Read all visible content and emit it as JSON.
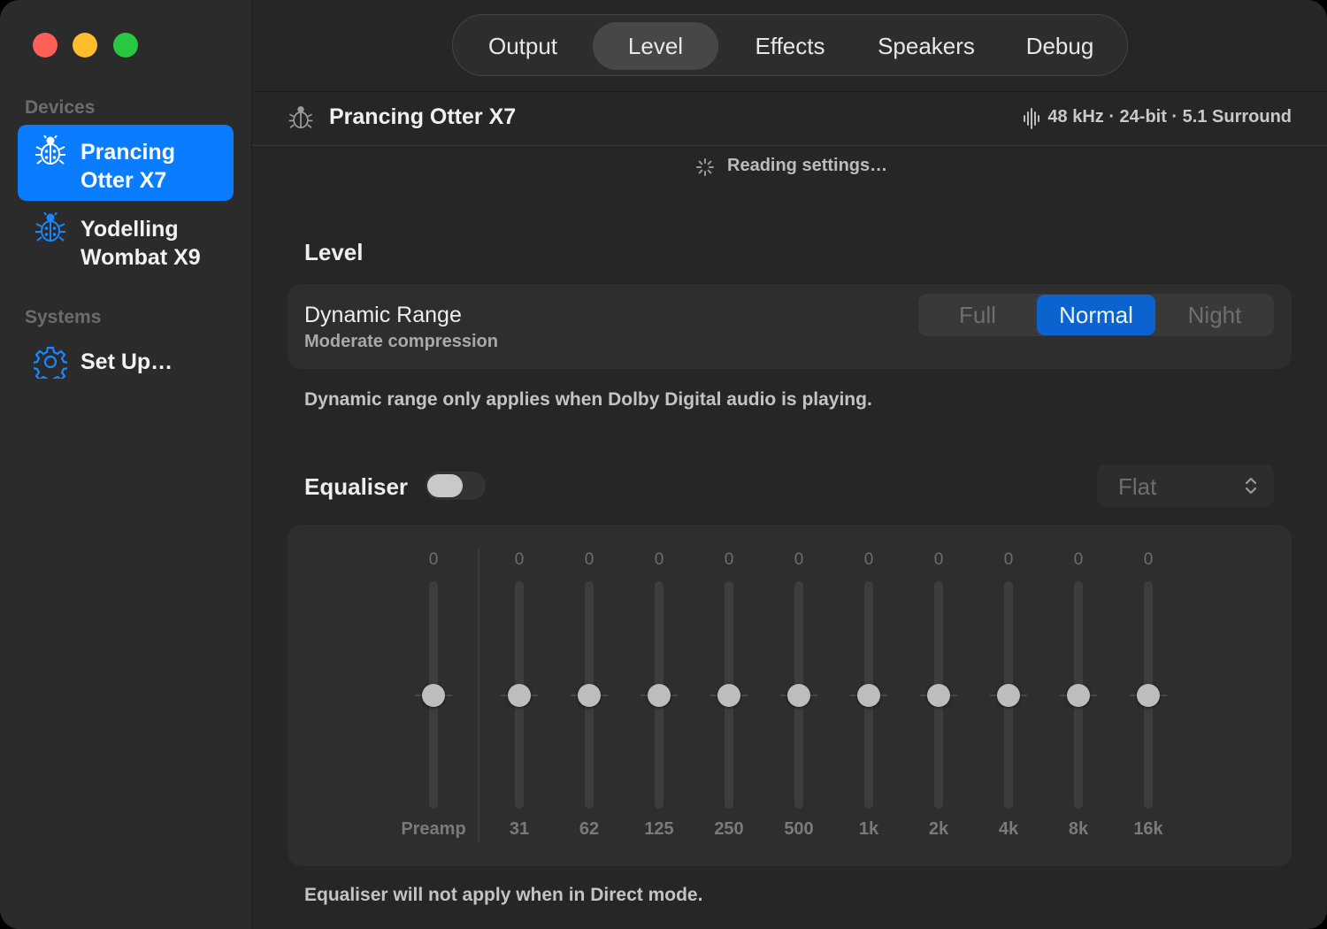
{
  "sidebar": {
    "devices_title": "Devices",
    "devices": [
      {
        "label": "Prancing Otter X7",
        "icon": "ladybug-icon",
        "selected": true
      },
      {
        "label": "Yodelling Wombat X9",
        "icon": "ladybug-icon",
        "selected": false
      }
    ],
    "systems_title": "Systems",
    "systems": [
      {
        "label": "Set Up…",
        "icon": "gear-icon"
      }
    ]
  },
  "tabs": [
    {
      "label": "Output",
      "active": false
    },
    {
      "label": "Level",
      "active": true
    },
    {
      "label": "Effects",
      "active": false
    },
    {
      "label": "Speakers",
      "active": false
    },
    {
      "label": "Debug",
      "active": false
    }
  ],
  "device_header": {
    "name": "Prancing Otter X7",
    "format": "48 kHz · 24-bit · 5.1 Surround"
  },
  "status": "Reading settings…",
  "level": {
    "title": "Level",
    "dynamic_range": {
      "label": "Dynamic Range",
      "description": "Moderate compression",
      "options": [
        "Full",
        "Normal",
        "Night"
      ],
      "selected": "Normal"
    },
    "note": "Dynamic range only applies when Dolby Digital audio is playing."
  },
  "equaliser": {
    "title": "Equaliser",
    "enabled": false,
    "preset": "Flat",
    "bands": [
      {
        "label": "Preamp",
        "value": "0"
      },
      {
        "label": "31",
        "value": "0"
      },
      {
        "label": "62",
        "value": "0"
      },
      {
        "label": "125",
        "value": "0"
      },
      {
        "label": "250",
        "value": "0"
      },
      {
        "label": "500",
        "value": "0"
      },
      {
        "label": "1k",
        "value": "0"
      },
      {
        "label": "2k",
        "value": "0"
      },
      {
        "label": "4k",
        "value": "0"
      },
      {
        "label": "8k",
        "value": "0"
      },
      {
        "label": "16k",
        "value": "0"
      }
    ],
    "note": "Equaliser will not apply when in Direct mode."
  },
  "colors": {
    "accent": "#0a7cff",
    "segment_selected": "#0a63ce",
    "window_bg": "#262626",
    "sidebar_bg": "#2b2b2b"
  }
}
